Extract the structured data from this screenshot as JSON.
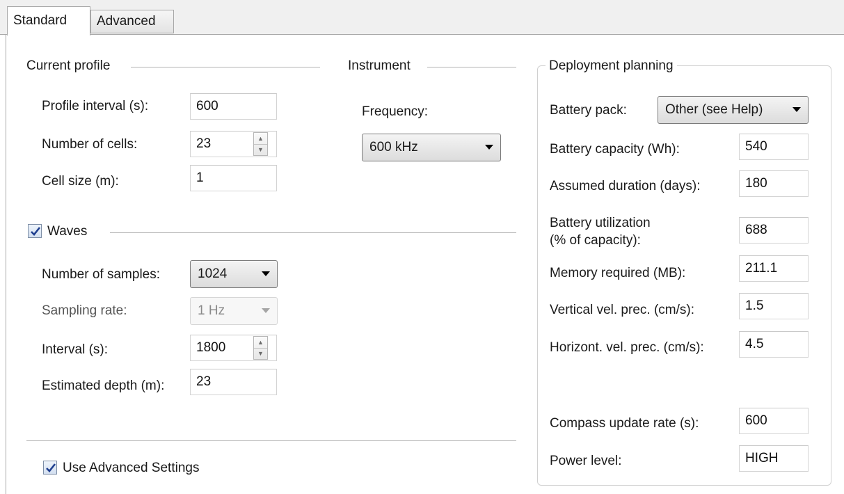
{
  "tabs": [
    {
      "label": "Standard",
      "active": true
    },
    {
      "label": "Advanced",
      "active": false
    }
  ],
  "current_profile": {
    "title": "Current profile",
    "profile_interval": {
      "label": "Profile interval (s):",
      "value": "600"
    },
    "number_of_cells": {
      "label": "Number of cells:",
      "value": "23"
    },
    "cell_size": {
      "label": "Cell size (m):",
      "value": "1"
    }
  },
  "instrument": {
    "title": "Instrument",
    "frequency_label": "Frequency:",
    "frequency_value": "600 kHz"
  },
  "waves": {
    "label": "Waves",
    "checked": true,
    "number_of_samples": {
      "label": "Number of samples:",
      "value": "1024"
    },
    "sampling_rate": {
      "label": "Sampling rate:",
      "value": "1 Hz",
      "enabled": false
    },
    "interval": {
      "label": "Interval (s):",
      "value": "1800"
    },
    "estimated_depth": {
      "label": "Estimated depth (m):",
      "value": "23"
    }
  },
  "use_advanced": {
    "label": "Use Advanced Settings",
    "checked": true
  },
  "deployment": {
    "title": "Deployment planning",
    "battery_pack": {
      "label": "Battery pack:",
      "value": "Other (see Help)"
    },
    "battery_capacity": {
      "label": "Battery capacity (Wh):",
      "value": "540"
    },
    "assumed_duration": {
      "label": "Assumed duration (days):",
      "value": "180"
    },
    "battery_utilization": {
      "label_line1": "Battery utilization",
      "label_line2": "(% of capacity):",
      "value": "688"
    },
    "memory_required": {
      "label": "Memory required (MB):",
      "value": "211.1"
    },
    "vertical_prec": {
      "label": "Vertical vel. prec. (cm/s):",
      "value": "1.5"
    },
    "horizontal_prec": {
      "label": "Horizont. vel. prec. (cm/s):",
      "value": "4.5"
    },
    "compass_rate": {
      "label": "Compass update rate (s):",
      "value": "600"
    },
    "power_level": {
      "label": "Power level:",
      "value": "HIGH"
    }
  },
  "icons": {
    "spinner_up": "spinner-up-arrow-icon",
    "spinner_down": "spinner-down-arrow-icon",
    "dropdown": "dropdown-arrow-icon",
    "checkmark": "checkmark-icon"
  },
  "colors": {
    "checkmark": "#1f3f8f",
    "border": "#a8a8a8",
    "disabled_text": "#8a8a8a"
  }
}
